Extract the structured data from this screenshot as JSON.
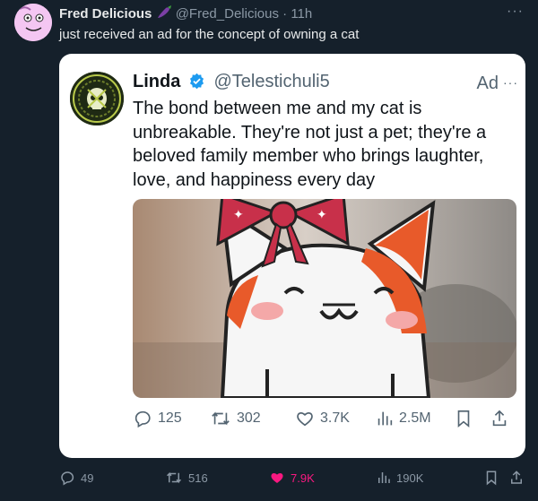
{
  "outer_post": {
    "author_name": "Fred Delicious",
    "author_emoji": "eggplant-icon",
    "handle": "@Fred_Delicious",
    "separator": "·",
    "time": "11h",
    "more_label": "···",
    "text": "just received an ad for the concept of owning a cat",
    "actions": {
      "replies": "49",
      "reposts": "516",
      "likes": "7.9K",
      "views": "190K"
    },
    "like_color": "#f91880"
  },
  "quoted_post": {
    "author_name": "Linda",
    "verified": true,
    "handle": "@Telestichuli5",
    "ad_label": "Ad",
    "more_label": "···",
    "text": "The bond between me and my cat is unbreakable. They're not just a pet; they're a beloved family member who brings laughter, love, and happiness every day",
    "actions": {
      "replies": "125",
      "reposts": "302",
      "likes": "3.7K",
      "views": "2.5M"
    },
    "verified_color": "#1d9bf0"
  },
  "theme": {
    "background": "#15202b",
    "card_background": "#ffffff"
  }
}
